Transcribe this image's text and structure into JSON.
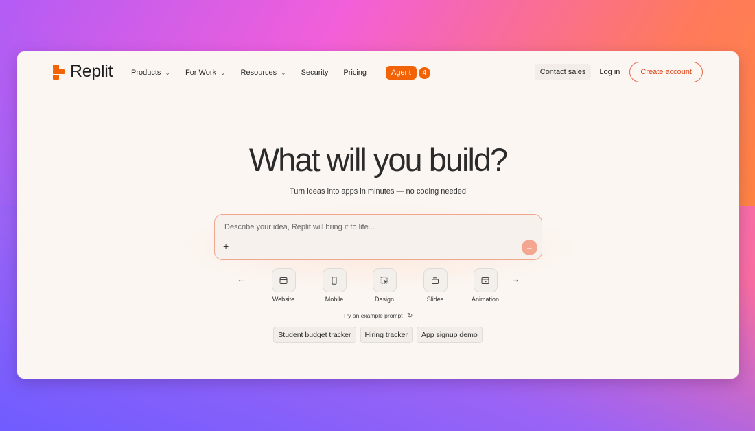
{
  "brand": {
    "name": "Replit",
    "accent": "#f26207"
  },
  "nav": {
    "items": [
      {
        "label": "Products",
        "dropdown": true
      },
      {
        "label": "For Work",
        "dropdown": true
      },
      {
        "label": "Resources",
        "dropdown": true
      },
      {
        "label": "Security",
        "dropdown": false
      },
      {
        "label": "Pricing",
        "dropdown": false
      }
    ],
    "agent_label": "Agent",
    "agent_badge": "4",
    "contact_sales": "Contact sales",
    "login": "Log in",
    "create_account": "Create account"
  },
  "hero": {
    "title": "What will you build?",
    "subtitle": "Turn ideas into apps in minutes — no coding needed"
  },
  "prompt": {
    "placeholder": "Describe your idea, Replit will bring it to life...",
    "value": ""
  },
  "types": [
    {
      "label": "Website",
      "icon": "browser-window-icon"
    },
    {
      "label": "Mobile",
      "icon": "phone-icon"
    },
    {
      "label": "Design",
      "icon": "design-cursor-icon"
    },
    {
      "label": "Slides",
      "icon": "slides-stack-icon"
    },
    {
      "label": "Animation",
      "icon": "animation-window-icon"
    }
  ],
  "examples": {
    "label": "Try an example prompt",
    "chips": [
      "Student budget tracker",
      "Hiring tracker",
      "App signup demo"
    ]
  }
}
